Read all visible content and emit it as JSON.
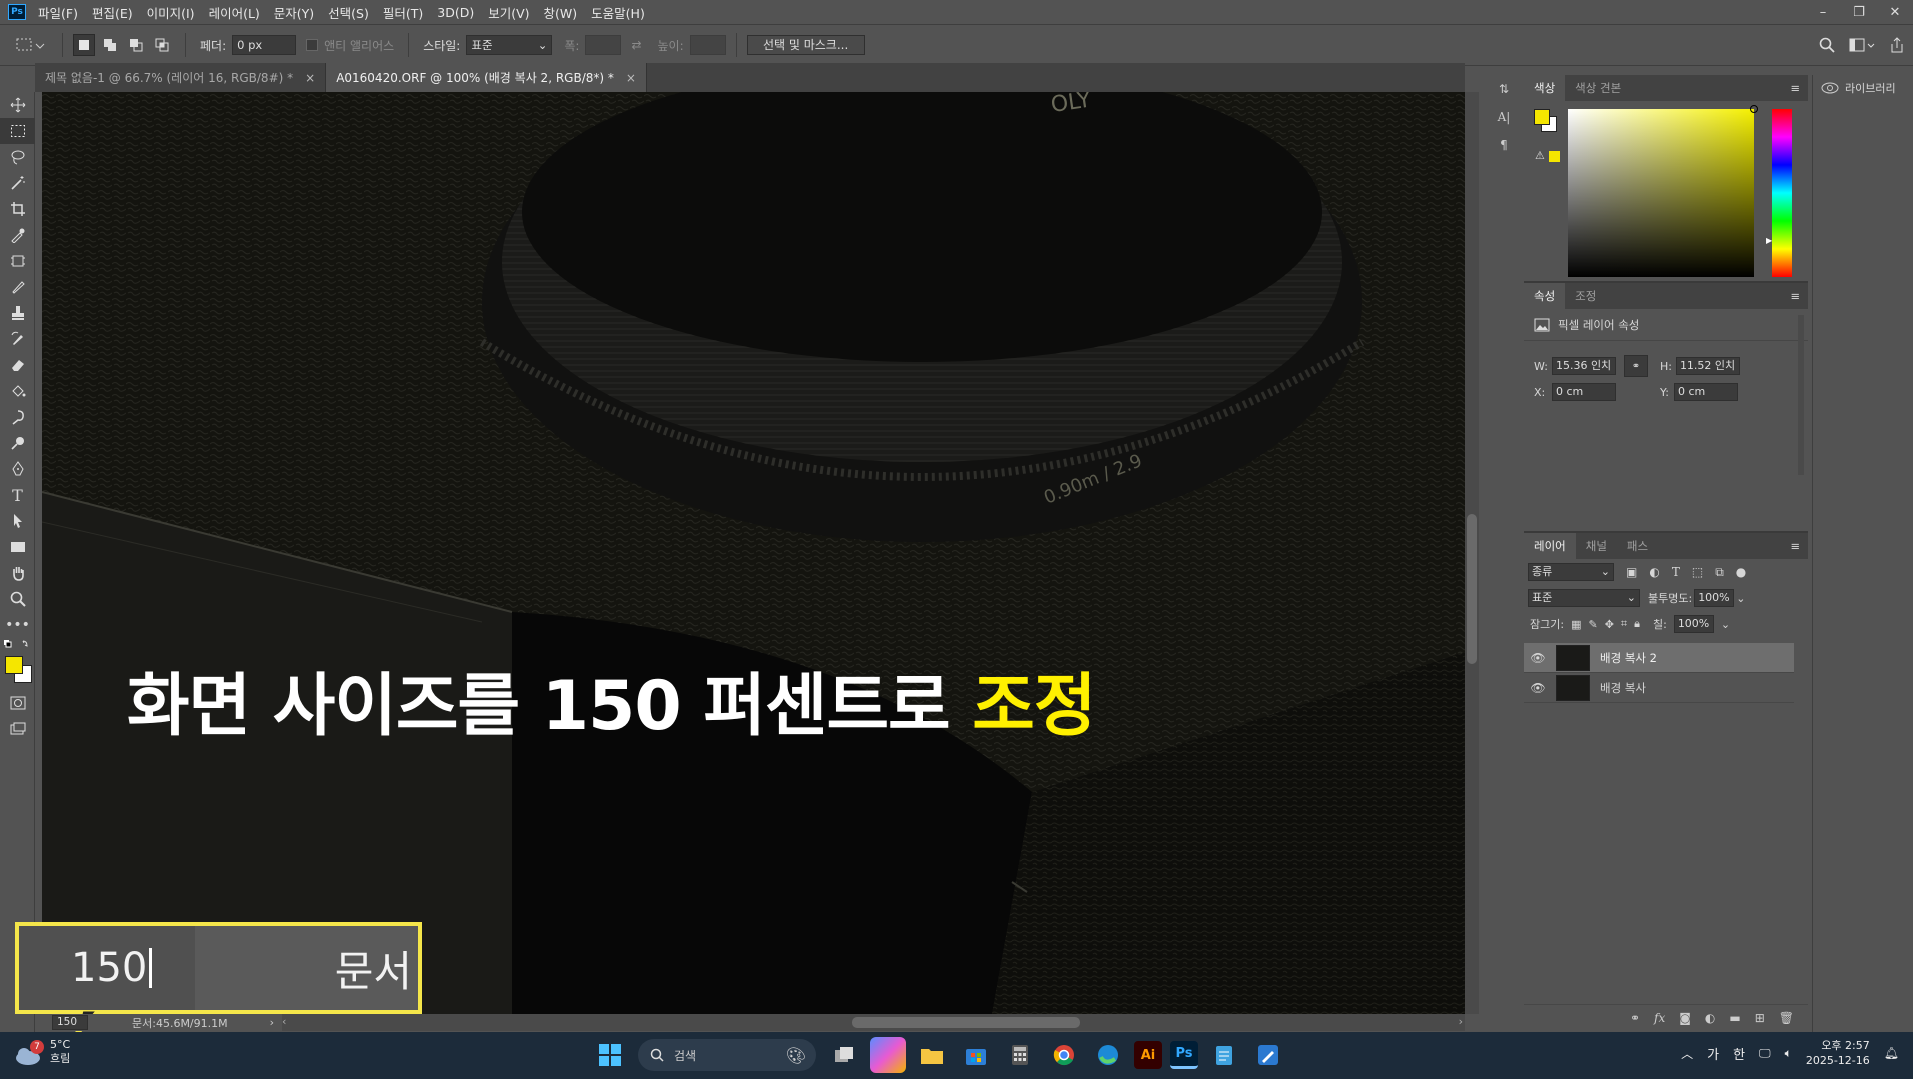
{
  "menubar": {
    "logo": "Ps",
    "items": [
      "파일(F)",
      "편집(E)",
      "이미지(I)",
      "레이어(L)",
      "문자(Y)",
      "선택(S)",
      "필터(T)",
      "3D(D)",
      "보기(V)",
      "창(W)",
      "도움말(H)"
    ]
  },
  "window_controls": {
    "minimize": "–",
    "restore": "❐",
    "close": "✕"
  },
  "options": {
    "feather_label": "페더:",
    "feather_value": "0 px",
    "antialias_label": "앤티 앨리어스",
    "style_label": "스타일:",
    "style_value": "표준",
    "width_label": "폭:",
    "height_label": "높이:",
    "select_mask_button": "선택 및 마스크..."
  },
  "tabs": [
    {
      "label": "제목 없음-1 @ 66.7% (레이어 16, RGB/8#) *",
      "close": "×"
    },
    {
      "label": "A0160420.ORF @ 100% (배경 복사 2, RGB/8*) *",
      "close": "×"
    }
  ],
  "canvas": {
    "caption_white": "화면 사이즈를 150 퍼센트로",
    "caption_yellow": "조정",
    "zoom_callout_value": "150",
    "zoom_callout_label": "문서",
    "lens_text": "0.90m / 2.9"
  },
  "status": {
    "zoom": "150",
    "doc": "문서:45.6M/91.1M"
  },
  "color_panel": {
    "tabs": [
      "색상",
      "색상 견본"
    ],
    "fg_color": "#f5e600",
    "bg_color": "#ffffff"
  },
  "properties_panel": {
    "tabs": [
      "속성",
      "조정"
    ],
    "title": "픽셀 레이어 속성",
    "w_label": "W:",
    "w_value": "15.36 인치",
    "h_label": "H:",
    "h_value": "11.52 인치",
    "x_label": "X:",
    "x_value": "0 cm",
    "y_label": "Y:",
    "y_value": "0 cm"
  },
  "layers_panel": {
    "tabs": [
      "레이어",
      "채널",
      "패스"
    ],
    "filter_kind": "종류",
    "blend_mode": "표준",
    "opacity_label": "불투명도:",
    "opacity_value": "100%",
    "lock_label": "잠그기:",
    "fill_label": "칠:",
    "fill_value": "100%",
    "layers": [
      {
        "name": "배경 복사 2",
        "selected": true
      },
      {
        "name": "배경 복사",
        "selected": false
      }
    ]
  },
  "library": {
    "label": "라이브러리"
  },
  "taskbar": {
    "weather_temp": "5°C",
    "weather_desc": "흐림",
    "weather_badge": "7",
    "search_placeholder": "검색",
    "ime_1": "가",
    "ime_2": "한",
    "time": "오후 2:57",
    "date": "2025-12-16"
  }
}
